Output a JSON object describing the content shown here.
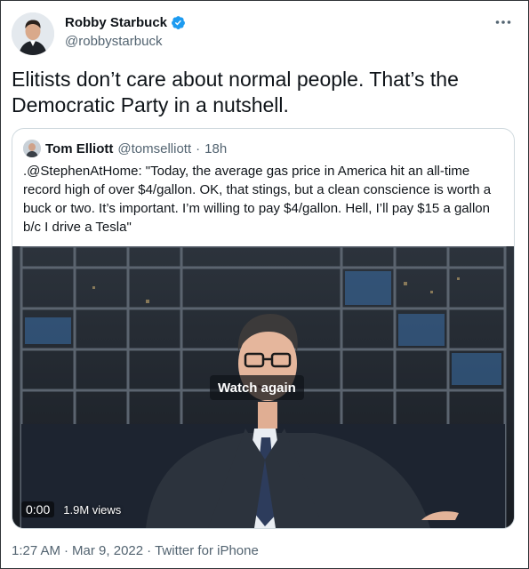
{
  "author": {
    "name": "Robby Starbuck",
    "handle": "@robbystarbuck",
    "verified_color": "#1d9bf0"
  },
  "tweet": {
    "text": "Elitists don’t care about normal people. That’s the Democratic Party in a nutshell."
  },
  "quoted": {
    "name": "Tom Elliott",
    "handle": "@tomselliott",
    "separator": "·",
    "time": "18h",
    "text": ".@StephenAtHome: \"Today, the average gas price in America hit an all-time record high of over $4/gallon. OK, that stings, but a clean conscience is worth a buck or two. It’s important. I’m willing to pay $4/gallon. Hell, I’ll pay $15 a gallon b/c I drive a Tesla\"",
    "video": {
      "overlay_label": "Watch again",
      "elapsed": "0:00",
      "views": "1.9M views"
    }
  },
  "meta": {
    "time": "1:27 AM",
    "separator1": "·",
    "date": "Mar 9, 2022",
    "separator2": "·",
    "source": "Twitter for iPhone"
  },
  "icons": {
    "more": "more-icon",
    "verified": "verified-badge-icon"
  }
}
